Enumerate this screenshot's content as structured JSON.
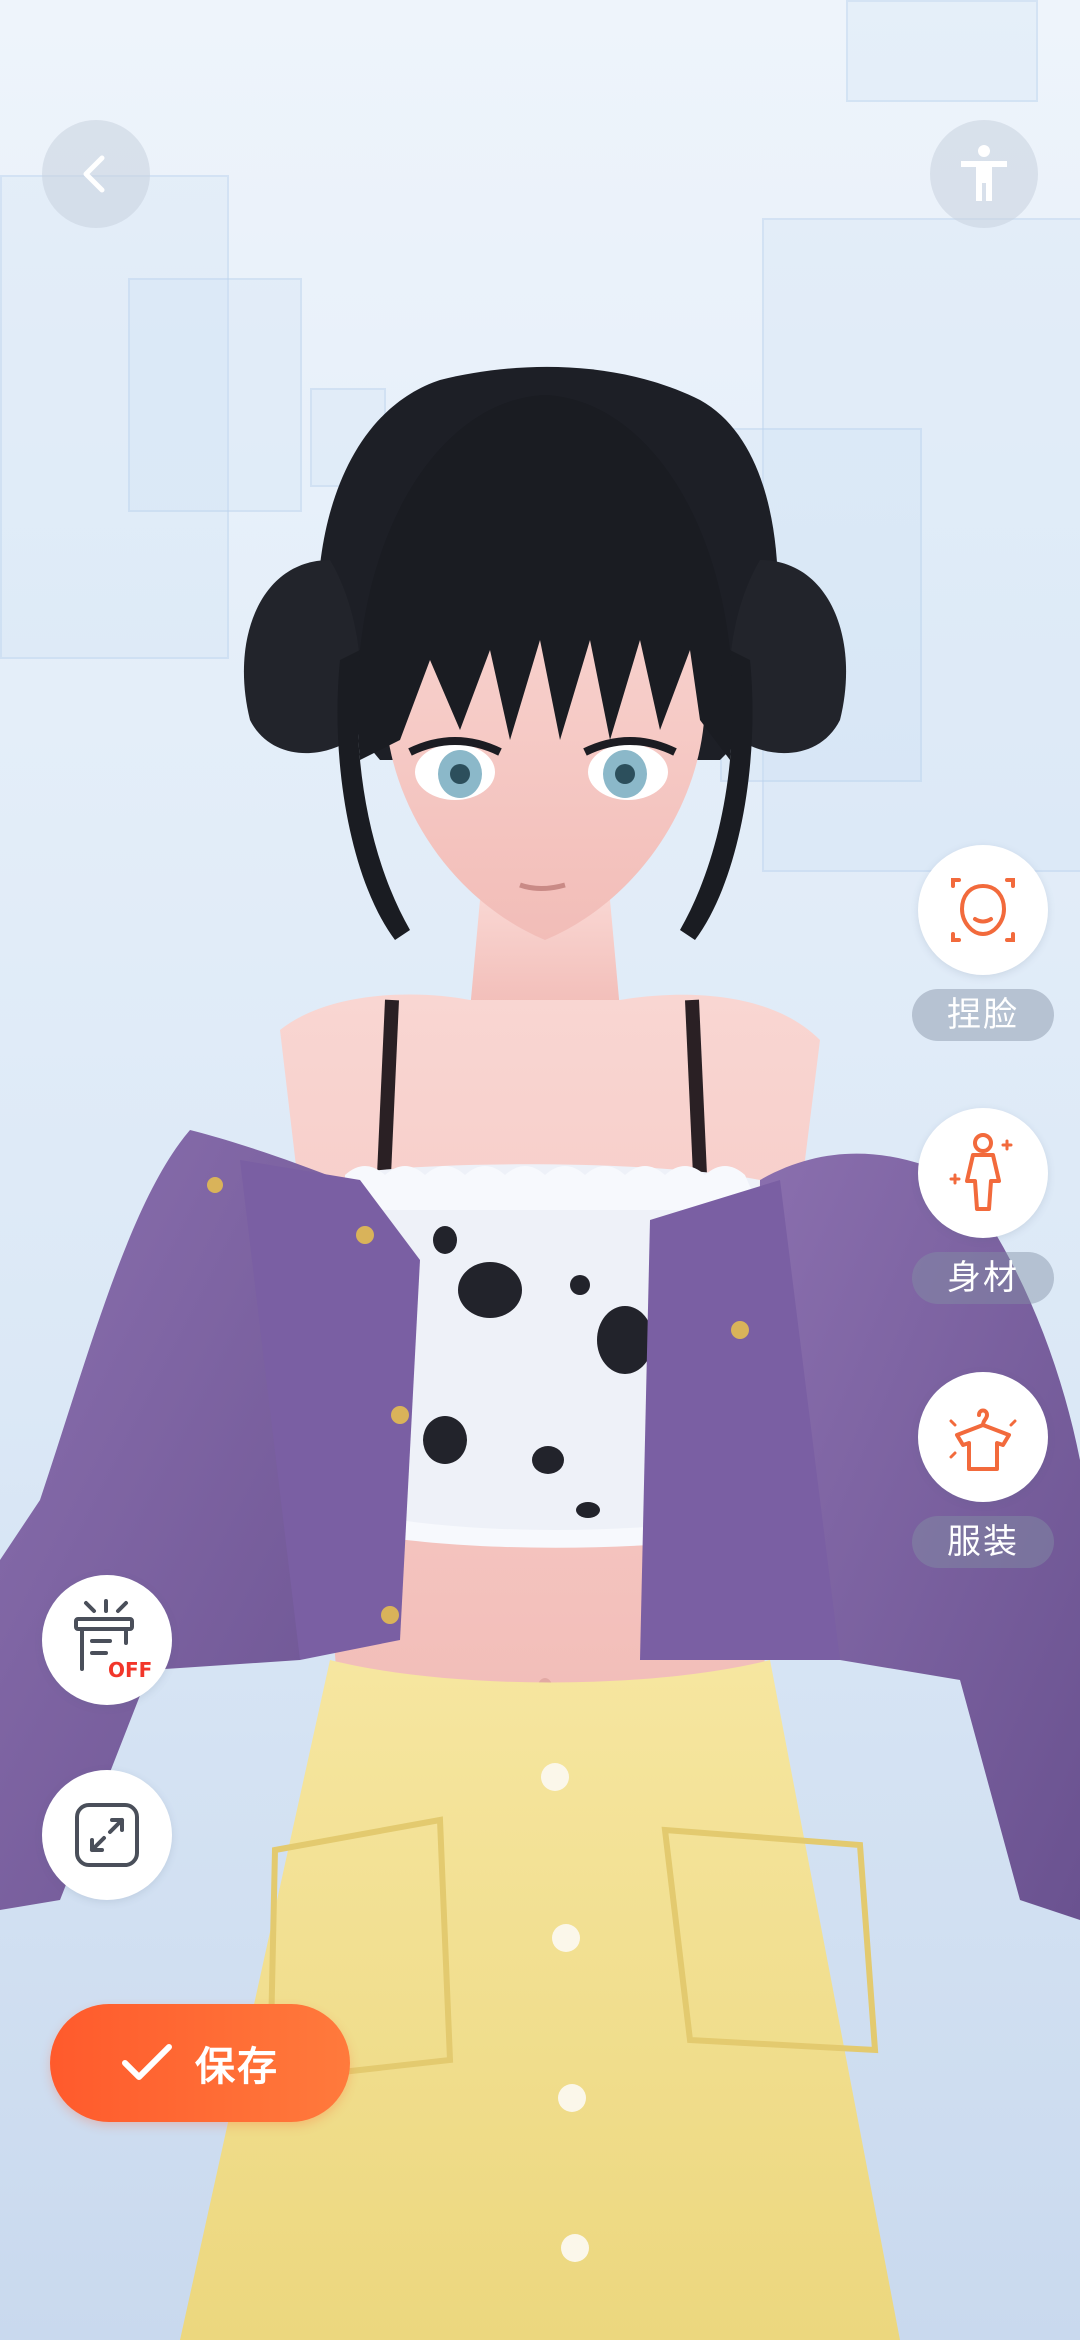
{
  "colors": {
    "accent": "#ff5a2c",
    "icon_orange": "#f26a3c",
    "label_bg": "#8291a5"
  },
  "top_bar": {
    "back_icon": "chevron-left-icon",
    "pose_icon": "standing-figure-icon"
  },
  "side_tools": [
    {
      "label": "捏脸",
      "icon": "face-sculpt-icon"
    },
    {
      "label": "身材",
      "icon": "body-shape-icon"
    },
    {
      "label": "服装",
      "icon": "clothing-hanger-icon"
    }
  ],
  "left_tools": {
    "background_toggle": {
      "icon": "stage-background-icon",
      "badge": "OFF"
    },
    "fullscreen": {
      "icon": "expand-arrows-icon"
    }
  },
  "save_button": {
    "label": "保存",
    "icon": "checkmark-icon"
  }
}
